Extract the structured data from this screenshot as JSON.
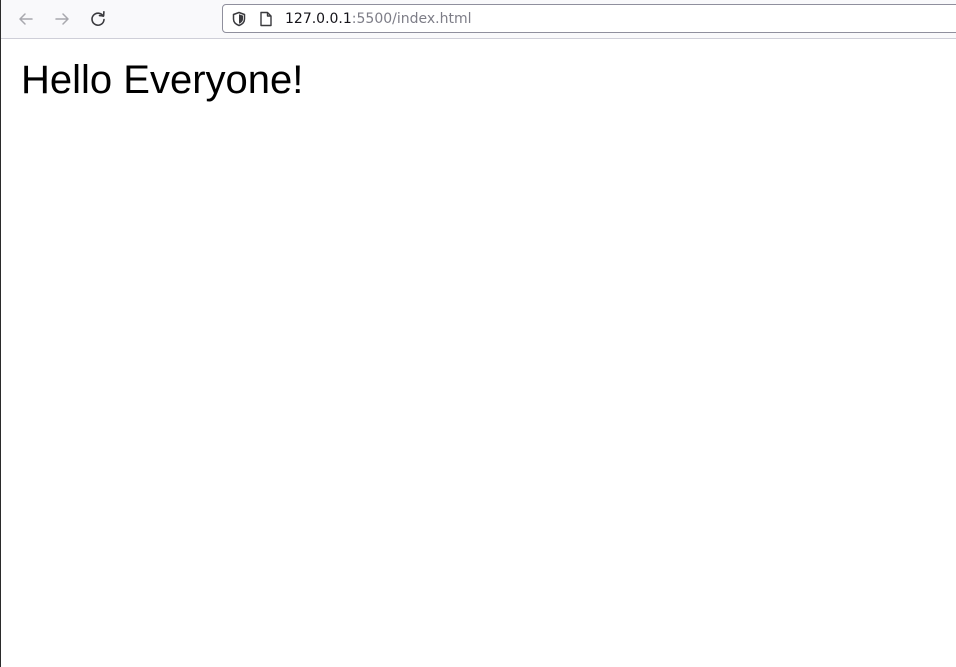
{
  "browser": {
    "url_host": "127.0.0.1",
    "url_rest": ":5500/index.html",
    "icons": {
      "back": "arrow-left-icon",
      "forward": "arrow-right-icon",
      "reload": "reload-icon",
      "security": "shield-icon",
      "page": "page-icon"
    },
    "colors": {
      "toolbar_bg": "#f9f9fb",
      "url_host": "#15141a",
      "url_rest": "#7d7d87",
      "disabled_icon": "#a8a8ae",
      "active_icon": "#3a3a3e"
    }
  },
  "page": {
    "heading": "Hello Everyone!"
  }
}
